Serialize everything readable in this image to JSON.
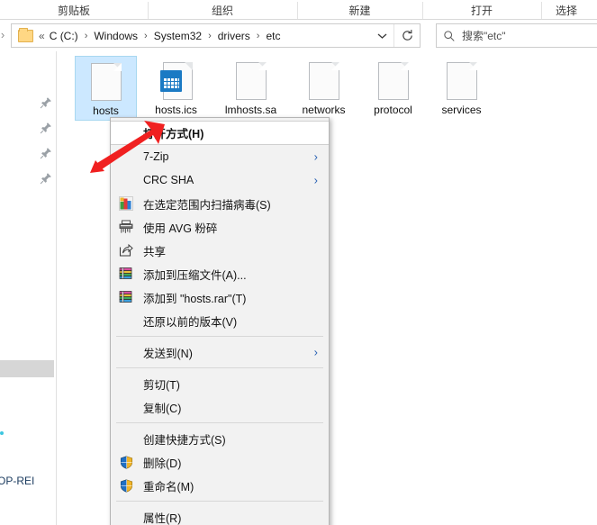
{
  "ribbon": {
    "groups": [
      {
        "label": "剪贴板"
      },
      {
        "label": "组织"
      },
      {
        "label": "新建"
      },
      {
        "label": "打开"
      },
      {
        "label": "选择"
      }
    ]
  },
  "navbar": {
    "forward_icon": "forward-arrow-icon",
    "breadcrumb_lead": "«",
    "crumbs": [
      "C (C:)",
      "Windows",
      "System32",
      "drivers",
      "etc"
    ],
    "crumb_separator": "›",
    "dropdown_icon": "chevron-down-icon",
    "refresh_icon": "refresh-icon",
    "refresh_glyph": "↻",
    "search": {
      "icon": "search-icon",
      "placeholder": "搜索\"etc\""
    }
  },
  "left_pane": {
    "pin_icon": "pin-icon",
    "pin_count": 4,
    "pc_label": "OP-REI"
  },
  "files": [
    {
      "name": "hosts",
      "icon": "blank-file-icon",
      "selected": true
    },
    {
      "name": "hosts.ics",
      "icon": "calendar-file-icon",
      "selected": false
    },
    {
      "name": "lmhosts.sa",
      "icon": "blank-file-icon",
      "selected": false
    },
    {
      "name": "networks",
      "icon": "blank-file-icon",
      "selected": false
    },
    {
      "name": "protocol",
      "icon": "blank-file-icon",
      "selected": false
    },
    {
      "name": "services",
      "icon": "blank-file-icon",
      "selected": false
    }
  ],
  "context_menu": {
    "items": [
      {
        "label": "打开方式(H)",
        "icon": null,
        "submenu": false,
        "highlight": true,
        "sep_after": false
      },
      {
        "label": "7-Zip",
        "icon": null,
        "submenu": true,
        "highlight": false,
        "sep_after": false
      },
      {
        "label": "CRC SHA",
        "icon": null,
        "submenu": true,
        "highlight": false,
        "sep_after": false
      },
      {
        "label": "在选定范围内扫描病毒(S)",
        "icon": "avg-scan-icon",
        "submenu": false,
        "highlight": false,
        "sep_after": false
      },
      {
        "label": "使用 AVG 粉碎",
        "icon": "shredder-icon",
        "submenu": false,
        "highlight": false,
        "sep_after": false
      },
      {
        "label": "共享",
        "icon": "share-icon",
        "submenu": false,
        "highlight": false,
        "sep_after": false
      },
      {
        "label": "添加到压缩文件(A)...",
        "icon": "winrar-icon",
        "submenu": false,
        "highlight": false,
        "sep_after": false
      },
      {
        "label": "添加到 \"hosts.rar\"(T)",
        "icon": "winrar-icon",
        "submenu": false,
        "highlight": false,
        "sep_after": false
      },
      {
        "label": "还原以前的版本(V)",
        "icon": null,
        "submenu": false,
        "highlight": false,
        "sep_after": true
      },
      {
        "label": "发送到(N)",
        "icon": null,
        "submenu": true,
        "highlight": false,
        "sep_after": true
      },
      {
        "label": "剪切(T)",
        "icon": null,
        "submenu": false,
        "highlight": false,
        "sep_after": false
      },
      {
        "label": "复制(C)",
        "icon": null,
        "submenu": false,
        "highlight": false,
        "sep_after": true
      },
      {
        "label": "创建快捷方式(S)",
        "icon": null,
        "submenu": false,
        "highlight": false,
        "sep_after": false
      },
      {
        "label": "删除(D)",
        "icon": "uac-shield-icon",
        "submenu": false,
        "highlight": false,
        "sep_after": false
      },
      {
        "label": "重命名(M)",
        "icon": "uac-shield-icon",
        "submenu": false,
        "highlight": false,
        "sep_after": true
      },
      {
        "label": "属性(R)",
        "icon": null,
        "submenu": false,
        "highlight": false,
        "sep_after": false
      }
    ],
    "submenu_glyph": "›"
  },
  "annotation": {
    "arrow_icon": "red-arrow-annotation",
    "color": "#f02020"
  },
  "colors": {
    "selection": "#cce8ff",
    "menu_bg": "#f2f2f2",
    "accent_blue": "#2b63b5",
    "annotation_red": "#f02020"
  }
}
